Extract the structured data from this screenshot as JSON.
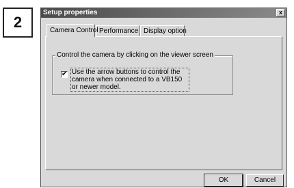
{
  "step": "2",
  "window": {
    "title": "Setup properties",
    "close_label": "x"
  },
  "tabs": [
    {
      "label": "Camera Control",
      "active": true
    },
    {
      "label": "Performance",
      "active": false
    },
    {
      "label": "Display option",
      "active": false
    }
  ],
  "group": {
    "legend": "Control the camera by clicking on the viewer screen",
    "checkbox_checked": true,
    "checkbox_mark": "✔",
    "checkbox_label": "Use the arrow buttons to control the camera when connected to a VB150 or newer model."
  },
  "buttons": {
    "ok": "OK",
    "cancel": "Cancel"
  }
}
